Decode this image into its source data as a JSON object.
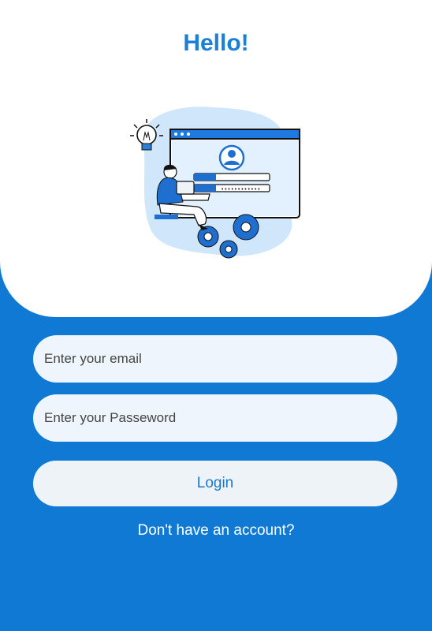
{
  "header": {
    "title": "Hello!"
  },
  "form": {
    "email_placeholder": "Enter your email",
    "password_placeholder": "Enter your Passeword",
    "login_label": "Login",
    "signup_prompt": "Don't have an account?"
  },
  "illustration": {
    "subject": "person-with-laptop-login-screen"
  },
  "colors": {
    "primary": "#0f79d3",
    "title": "#1a7fd6",
    "field_background": "#eef5fc",
    "white": "#ffffff"
  }
}
